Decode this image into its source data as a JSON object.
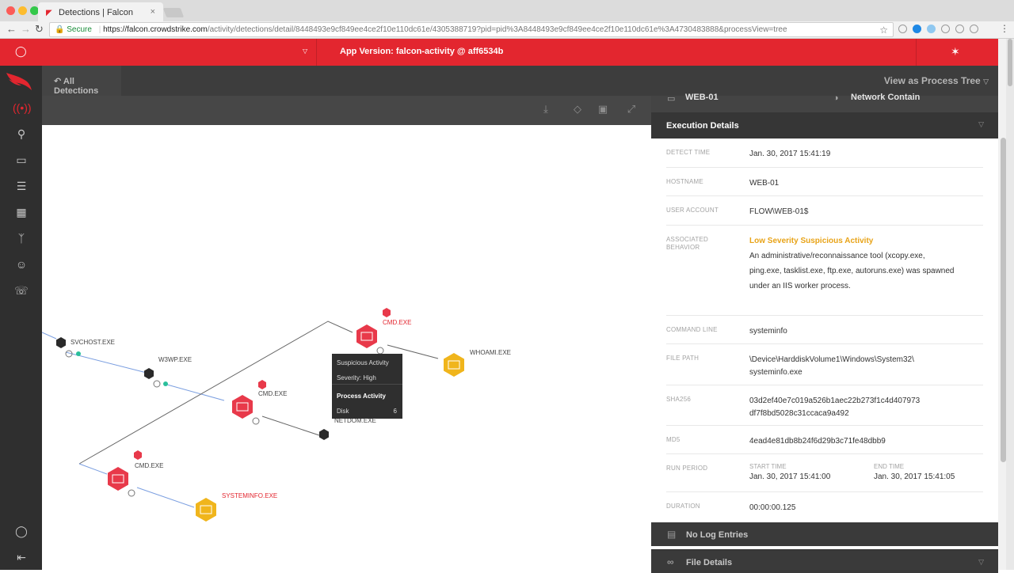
{
  "browser": {
    "tab_title": "Detections | Falcon",
    "secure_label": "Secure",
    "url_host": "https://falcon.crowdstrike.com",
    "url_path": "/activity/detections/detail/8448493e9cf849ee4ce2f10e110dc61e/4305388719?pid=pid%3A8448493e9cf849ee4ce2f10e110dc61e%3A4730483888&processView=tree"
  },
  "banner": {
    "app_version": "App Version: falcon-activity @ aff6534b"
  },
  "topbar": {
    "back_label": "All Detections",
    "view_label": "View as Process Tree"
  },
  "graph": {
    "nodes": {
      "svchost": "SVCHOST.EXE",
      "w3wp": "W3WP.EXE",
      "cmd_top": "CMD.EXE",
      "whoami": "WHOAMI.EXE",
      "cmd_mid": "CMD.EXE",
      "netdom": "NETDOM.EXE",
      "cmd_low": "CMD.EXE",
      "systeminfo": "SYSTEMINFO.EXE"
    },
    "tooltip": {
      "title": "Suspicious Activity",
      "severity": "Severity: High",
      "section": "Process Activity",
      "metric_label": "Disk",
      "metric_value": "6"
    }
  },
  "panel": {
    "host": "WEB-01",
    "network_contain": "Network Contain",
    "section_title": "Execution Details",
    "detect_time_label": "DETECT TIME",
    "detect_time": "Jan. 30, 2017 15:41:19",
    "hostname_label": "HOSTNAME",
    "hostname": "WEB-01",
    "user_label": "USER ACCOUNT",
    "user": "FLOW\\WEB-01$",
    "behavior_label": "ASSOCIATED BEHAVIOR",
    "behavior_title": "Low Severity Suspicious Activity",
    "behavior_desc": "An administrative/reconnaissance tool (xcopy.exe, ping.exe, tasklist.exe, ftp.exe, autoruns.exe) was spawned under an IIS worker process.",
    "cmdline_label": "COMMAND LINE",
    "cmdline": "systeminfo",
    "filepath_label": "FILE PATH",
    "filepath": "\\Device\\HarddiskVolume1\\Windows\\System32\\ systeminfo.exe",
    "sha256_label": "SHA256",
    "sha256": "03d2ef40e7c019a526b1aec22b273f1c4d407973 df7f8bd5028c31ccaca9a492",
    "md5_label": "MD5",
    "md5": "4ead4e81db8b24f6d29b3c71fe48dbb9",
    "run_period_label": "RUN PERIOD",
    "start_label": "START TIME",
    "start_time": "Jan. 30, 2017 15:41:00",
    "end_label": "END TIME",
    "end_time": "Jan. 30, 2017 15:41:05",
    "duration_label": "DURATION",
    "duration": "00:00:00.125",
    "no_log": "No Log Entries",
    "file_details": "File Details"
  },
  "colors": {
    "brand_red": "#e3262f",
    "warn_yellow": "#f0b51c",
    "dark": "#2f2f2f"
  }
}
